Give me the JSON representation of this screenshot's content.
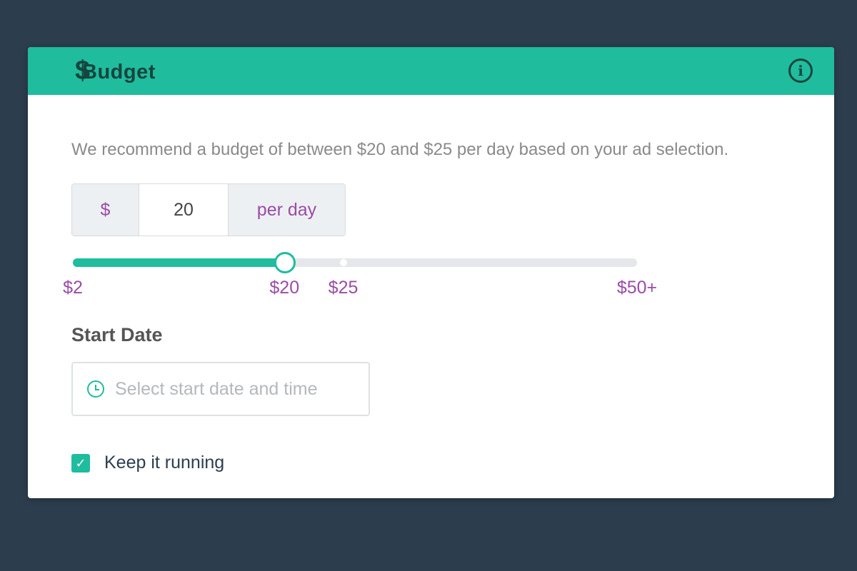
{
  "header": {
    "icon": "dollar-icon",
    "currency_symbol": "$",
    "title": "Budget",
    "info_icon": "info-icon"
  },
  "recommendation": "We recommend a budget of between $20 and $25 per day based on your ad selection.",
  "budget": {
    "currency": "$",
    "amount": "20",
    "unit": "per day"
  },
  "slider": {
    "min": 2,
    "max": 50,
    "value": 20,
    "recommended_max": 25,
    "tick_labels": [
      "$2",
      "$20",
      "$25",
      "$50+"
    ],
    "tick_values": [
      2,
      20,
      25,
      50
    ]
  },
  "start_date": {
    "label": "Start Date",
    "placeholder": "Select start date and time",
    "icon": "clock-icon"
  },
  "keep_running": {
    "label": "Keep it running",
    "checked": true,
    "check_glyph": "✓"
  },
  "colors": {
    "background": "#2c3d4e",
    "accent": "#20bc9e",
    "header_text": "#16453f",
    "purple": "#9b4ba8"
  }
}
